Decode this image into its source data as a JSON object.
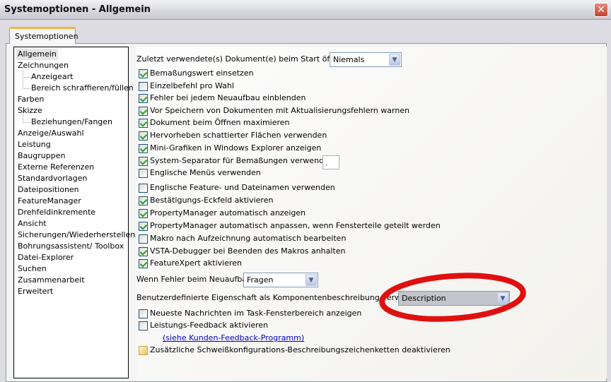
{
  "window": {
    "title": "Systemoptionen - Allgemein",
    "close_icon": "close-icon"
  },
  "tab": {
    "label": "Systemoptionen"
  },
  "tree": [
    "Allgemein",
    "Zeichnungen",
    "Anzeigeart",
    "Bereich schraffieren/füllen",
    "Farben",
    "Skizze",
    "Beziehungen/Fangen",
    "Anzeige/Auswahl",
    "Leistung",
    "Baugruppen",
    "Externe Referenzen",
    "Standardvorlagen",
    "Dateipositionen",
    "FeatureManager",
    "Drehfeldinkremente",
    "Ansicht",
    "Sicherungen/Wiederherstellen",
    "Bohrungsassistent/ Toolbox",
    "Datei-Explorer",
    "Suchen",
    "Zusammenarbeit",
    "Erweitert"
  ],
  "main": {
    "recent_label": "Zuletzt verwendete(s) Dokument(e) beim Start öffnen:",
    "recent_value": "Niemals",
    "options": [
      {
        "label": "Bemaßungswert einsetzen",
        "checked": true
      },
      {
        "label": "Einzelbefehl pro Wahl",
        "checked": false
      },
      {
        "label": "Fehler bei jedem Neuaufbau einblenden",
        "checked": true
      },
      {
        "label": "Vor Speichern von Dokumenten mit Aktualisierungsfehlern warnen",
        "checked": true
      },
      {
        "label": "Dokument beim Öffnen maximieren",
        "checked": true
      },
      {
        "label": "Hervorheben schattierter Flächen verwenden",
        "checked": true
      },
      {
        "label": "Mini-Grafiken in Windows Explorer anzeigen",
        "checked": true
      },
      {
        "label": "System-Separator für Bemaßungen verwenden",
        "checked": true
      },
      {
        "label": "Englische Menüs verwenden",
        "checked": false
      },
      {
        "label": "Englische Feature- und Dateinamen verwenden",
        "checked": false
      },
      {
        "label": "Bestätigungs-Eckfeld aktivieren",
        "checked": true
      },
      {
        "label": "PropertyManager automatisch anzeigen",
        "checked": true
      },
      {
        "label": "PropertyManager automatisch anpassen, wenn Fensterteile geteilt werden",
        "checked": true
      },
      {
        "label": "Makro nach Aufzeichnung automatisch bearbeiten",
        "checked": false
      },
      {
        "label": "VSTA-Debugger bei Beenden des Makros anhalten",
        "checked": true
      },
      {
        "label": "FeatureXpert aktivieren",
        "checked": true
      }
    ],
    "separator_value": ",",
    "rebuild_label": "Wenn Fehler beim Neuaufbau:",
    "rebuild_value": "Fragen",
    "custom_prop_label": "Benutzerdefinierte Eigenschaft als Komponentenbeschreibung verwendet:",
    "custom_prop_value": "Description",
    "news_label": "Neueste Nachrichten im Task-Fensterbereich anzeigen",
    "feedback_label": "Leistungs-Feedback aktivieren",
    "feedback_link": "(siehe Kunden-Feedback-Programm)",
    "weld_label": "Zusätzliche Schweißkonfigurations-Beschreibungszeichenketten deaktivieren"
  },
  "annotation_color": "#e01010"
}
